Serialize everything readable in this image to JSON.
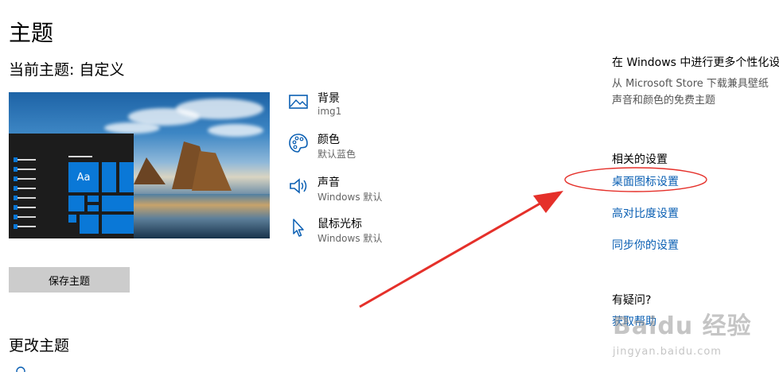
{
  "page": {
    "title": "主题",
    "current_theme": "当前主题: 自定义",
    "preview_tile_label": "Aa",
    "save_button": "保存主题",
    "change_theme": "更改主题"
  },
  "options": [
    {
      "title": "背景",
      "value": "img1",
      "icon": "picture-icon"
    },
    {
      "title": "颜色",
      "value": "默认蓝色",
      "icon": "palette-icon"
    },
    {
      "title": "声音",
      "value": "Windows 默认",
      "icon": "speaker-icon"
    },
    {
      "title": "鼠标光标",
      "value": "Windows 默认",
      "icon": "cursor-icon"
    }
  ],
  "right": {
    "more_heading": "在 Windows 中进行更多个性化设",
    "store_line1": "从 Microsoft Store 下载兼具壁纸",
    "store_line2": "声音和颜色的免费主题",
    "related_heading": "相关的设置",
    "links": [
      "桌面图标设置",
      "高对比度设置",
      "同步你的设置"
    ],
    "help_heading": "有疑问?",
    "help_link": "获取帮助"
  },
  "watermark": {
    "brand": "Baidu 经验",
    "url": "jingyan.baidu.com"
  },
  "colors": {
    "accent": "#0a78d7",
    "link": "#0a5fb3",
    "annotation": "#e5302a"
  }
}
